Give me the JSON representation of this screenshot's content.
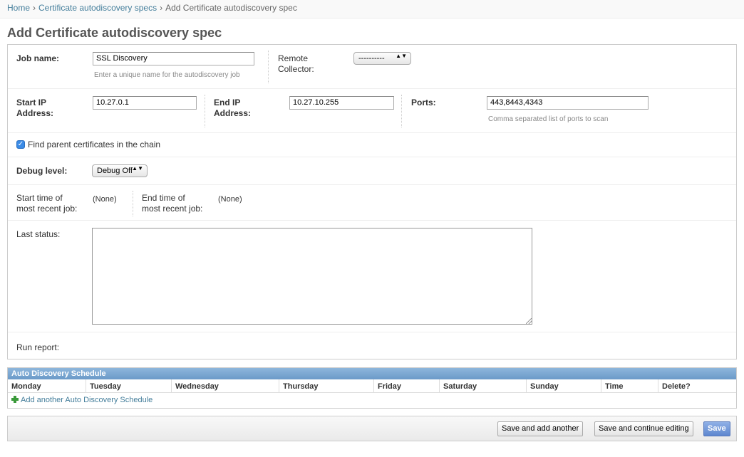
{
  "breadcrumb": {
    "home": "Home",
    "sep": "›",
    "specs": "Certificate autodiscovery specs",
    "current": "Add Certificate autodiscovery spec"
  },
  "title": "Add Certificate autodiscovery spec",
  "form": {
    "job_name": {
      "label": "Job name:",
      "value": "SSL Discovery",
      "help": "Enter a unique name for the autodiscovery job"
    },
    "remote_collector": {
      "label_line1": "Remote",
      "label_line2": "Collector:",
      "value": "----------"
    },
    "start_ip": {
      "label_line1": "Start IP",
      "label_line2": "Address:",
      "value": "10.27.0.1"
    },
    "end_ip": {
      "label_line1": "End IP",
      "label_line2": "Address:",
      "value": "10.27.10.255"
    },
    "ports": {
      "label": "Ports:",
      "value": "443,8443,4343",
      "help": "Comma separated list of ports to scan"
    },
    "find_parent": {
      "label": "Find parent certificates in the chain",
      "checked": true,
      "check_glyph": "✓"
    },
    "debug_level": {
      "label": "Debug level:",
      "value": "Debug Off"
    },
    "start_time": {
      "label_line1": "Start time of",
      "label_line2": "most recent job:",
      "value": "(None)"
    },
    "end_time": {
      "label_line1": "End time of",
      "label_line2": "most recent job:",
      "value": "(None)"
    },
    "last_status": {
      "label": "Last status:",
      "value": ""
    },
    "run_report": {
      "label": "Run report:"
    }
  },
  "schedule": {
    "caption": "Auto Discovery Schedule",
    "columns": [
      "Monday",
      "Tuesday",
      "Wednesday",
      "Thursday",
      "Friday",
      "Saturday",
      "Sunday",
      "Time",
      "Delete?"
    ],
    "add_link": "Add another Auto Discovery Schedule"
  },
  "actions": {
    "save_add": "Save and add another",
    "save_continue": "Save and continue editing",
    "save": "Save"
  },
  "colors": {
    "link": "#447e9b",
    "caption": "#7aa6d0",
    "checkbox": "#3b8be6",
    "primary_button": "#6d93d6"
  },
  "select_arrow": "▲▼"
}
